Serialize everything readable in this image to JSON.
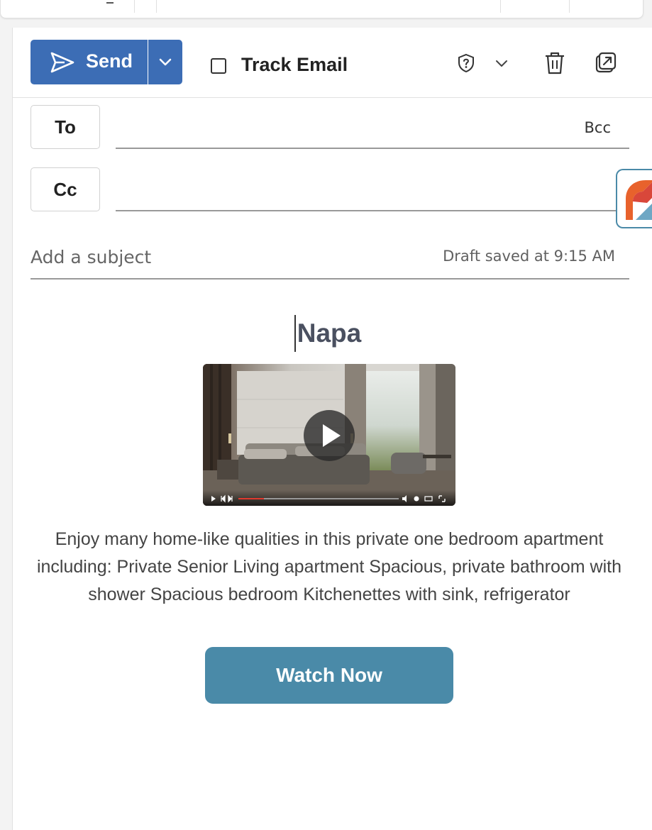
{
  "toolbar": {
    "send_label": "Send",
    "track_email_label": "Track Email",
    "track_email_checked": false,
    "icons": [
      "send-icon",
      "chevron-down-icon",
      "shield-question-icon",
      "chevron-down-icon",
      "trash-icon",
      "popout-icon"
    ]
  },
  "recipients": {
    "to_label": "To",
    "cc_label": "Cc",
    "bcc_label": "Bcc",
    "to_value": "",
    "cc_value": ""
  },
  "subject": {
    "placeholder": "Add a subject",
    "value": "",
    "draft_status": "Draft saved at 9:15 AM"
  },
  "body": {
    "title": "Napa",
    "description": "Enjoy many home-like qualities in this private one bedroom apartment including: Private Senior Living apartment Spacious, private bathroom with shower Spacious bedroom Kitchenettes with sink, refrigerator",
    "cta_label": "Watch Now"
  },
  "colors": {
    "send_button": "#3c6db5",
    "cta_button": "#4a8aa8",
    "title": "#4a5060"
  }
}
